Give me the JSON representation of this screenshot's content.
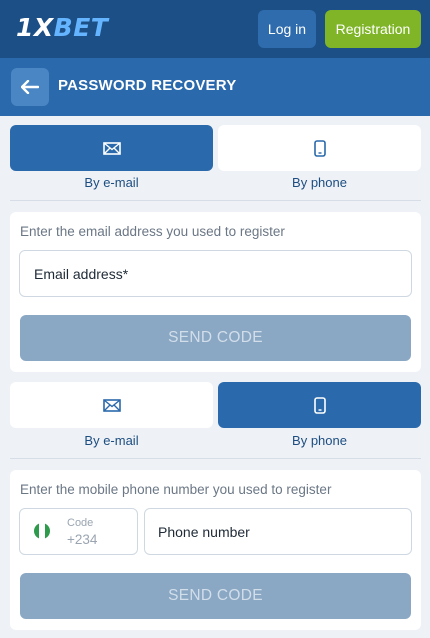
{
  "brand": {
    "logo_main": "1X",
    "logo_accent": "BET"
  },
  "header": {
    "login_label": "Log in",
    "registration_label": "Registration"
  },
  "subheader": {
    "title": "PASSWORD RECOVERY"
  },
  "tabs": {
    "email_label": "By e-mail",
    "phone_label": "By phone"
  },
  "email_form": {
    "hint": "Enter the email address you used to register",
    "email_placeholder": "Email address*",
    "send_label": "SEND CODE"
  },
  "phone_form": {
    "hint": "Enter the mobile phone number you used to register",
    "code_label": "Code",
    "code_value": "+234",
    "phone_placeholder": "Phone number",
    "send_label": "SEND CODE"
  },
  "colors": {
    "header_bg": "#1b4f86",
    "subheader_bg": "#2a69ab",
    "active_tab": "#2a69ab",
    "registration_btn": "#7fb527",
    "disabled_btn": "#8aa7c4",
    "flag_green": "#2e9a4b"
  }
}
